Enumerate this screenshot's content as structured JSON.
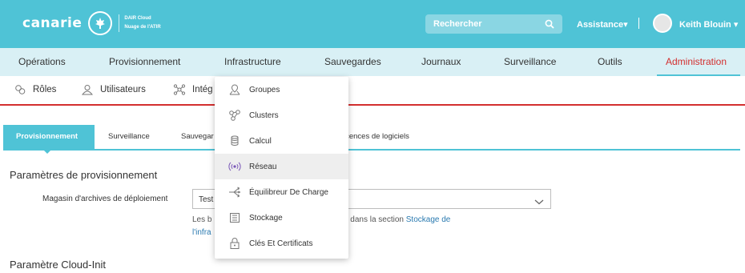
{
  "brand": {
    "name": "canarie",
    "sub_line1": "DAIR Cloud",
    "sub_line2": "Nuage de l'ATIR"
  },
  "header": {
    "search_placeholder": "Rechercher",
    "assistance_label": "Assistance",
    "user_name": "Keith Blouin"
  },
  "main_nav": {
    "items": [
      {
        "label": "Opérations",
        "active": false
      },
      {
        "label": "Provisionnement",
        "active": false
      },
      {
        "label": "Infrastructure",
        "active": false
      },
      {
        "label": "Sauvegardes",
        "active": false
      },
      {
        "label": "Journaux",
        "active": false
      },
      {
        "label": "Surveillance",
        "active": false
      },
      {
        "label": "Outils",
        "active": false
      },
      {
        "label": "Administration",
        "active": true
      }
    ]
  },
  "sub_nav": {
    "items": [
      {
        "label": "Rôles",
        "icon": "roles-icon"
      },
      {
        "label": "Utilisateurs",
        "icon": "user-icon"
      },
      {
        "label": "Intég",
        "icon": "integration-icon"
      }
    ]
  },
  "tabs": {
    "items": [
      {
        "label": "Provisionnement",
        "active": true
      },
      {
        "label": "Surveillance",
        "active": false
      },
      {
        "label": "Sauvegar",
        "active": false
      },
      {
        "label": "icences de logiciels",
        "active": false
      }
    ]
  },
  "content": {
    "section1_title": "Paramètres de provisionnement",
    "archive_label": "Magasin d'archives de déploiement",
    "archive_value": "Test",
    "help_prefix": "Les b",
    "help_mid": "gérés dans la section",
    "help_link": "Stockage de",
    "help_link2": "l'infra",
    "section2_title": "Paramètre Cloud-Init"
  },
  "infrastructure_menu": {
    "items": [
      {
        "label": "Groupes",
        "icon": "groups-icon",
        "hover": false
      },
      {
        "label": "Clusters",
        "icon": "clusters-icon",
        "hover": false
      },
      {
        "label": "Calcul",
        "icon": "compute-icon",
        "hover": false
      },
      {
        "label": "Réseau",
        "icon": "network-icon",
        "hover": true
      },
      {
        "label": "Équilibreur De Charge",
        "icon": "load-balancer-icon",
        "hover": false
      },
      {
        "label": "Stockage",
        "icon": "storage-icon",
        "hover": false
      },
      {
        "label": "Clés Et Certificats",
        "icon": "keys-icon",
        "hover": false
      }
    ]
  },
  "colors": {
    "accent": "#4fc3d6",
    "nav_bg": "#d9f0f5",
    "active_red": "#d32f2f",
    "link": "#2a7ab0"
  }
}
